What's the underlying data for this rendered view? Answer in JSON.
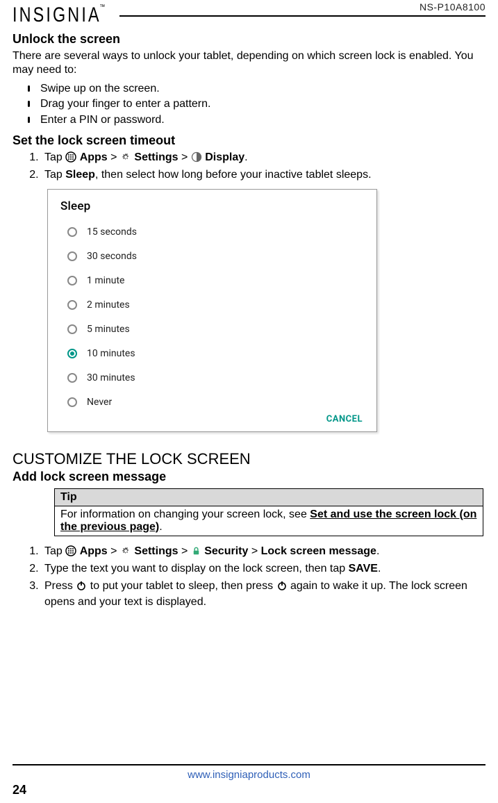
{
  "header": {
    "brand": "INSIGNIA",
    "trademark": "™",
    "model": "NS-P10A8100"
  },
  "section_unlock": {
    "title": "Unlock the screen",
    "intro": "There are several ways to unlock your tablet, depending on which screen lock is enabled. You may need to:",
    "bullets": [
      "Swipe up on the screen.",
      "Drag your finger to enter a pattern.",
      "Enter a PIN or password."
    ]
  },
  "section_timeout": {
    "title": "Set the lock screen timeout",
    "steps": {
      "s1_tap": "Tap ",
      "s1_apps": " Apps",
      "s1_gt1": " > ",
      "s1_settings": " Settings",
      "s1_gt2": " > ",
      "s1_display": " Display",
      "s1_end": ".",
      "s2_pre": "Tap ",
      "s2_sleep": "Sleep",
      "s2_post": ", then select how long before your inactive tablet sleeps."
    }
  },
  "sleep_dialog": {
    "title": "Sleep",
    "options": [
      {
        "label": "15 seconds",
        "selected": false
      },
      {
        "label": "30 seconds",
        "selected": false
      },
      {
        "label": "1 minute",
        "selected": false
      },
      {
        "label": "2 minutes",
        "selected": false
      },
      {
        "label": "5 minutes",
        "selected": false
      },
      {
        "label": "10 minutes",
        "selected": true
      },
      {
        "label": "30 minutes",
        "selected": false
      },
      {
        "label": "Never",
        "selected": false
      }
    ],
    "cancel": "CANCEL"
  },
  "section_customize": {
    "title": "CUSTOMIZE THE LOCK SCREEN"
  },
  "section_addmsg": {
    "title": "Add lock screen message",
    "tip_title": "Tip",
    "tip_body_pre": "For information on changing your screen lock, see ",
    "tip_link": "Set and use the screen lock (on the previous page)",
    "tip_body_post": ".",
    "steps": {
      "s1_tap": "Tap ",
      "s1_apps": " Apps",
      "s1_gt1": " > ",
      "s1_settings": " Settings",
      "s1_gt2": " > ",
      "s1_security": " Security",
      "s1_gt3": " > ",
      "s1_lockmsg": "Lock screen message",
      "s1_end": ".",
      "s2_pre": "Type the text you want to display on the lock screen, then tap ",
      "s2_save": "SAVE",
      "s2_end": ".",
      "s3_a": "Press ",
      "s3_b": " to put your tablet to sleep, then press ",
      "s3_c": " again to wake it up. The lock screen opens and your text is displayed."
    }
  },
  "footer": {
    "url": "www.insigniaproducts.com",
    "page": "24"
  }
}
